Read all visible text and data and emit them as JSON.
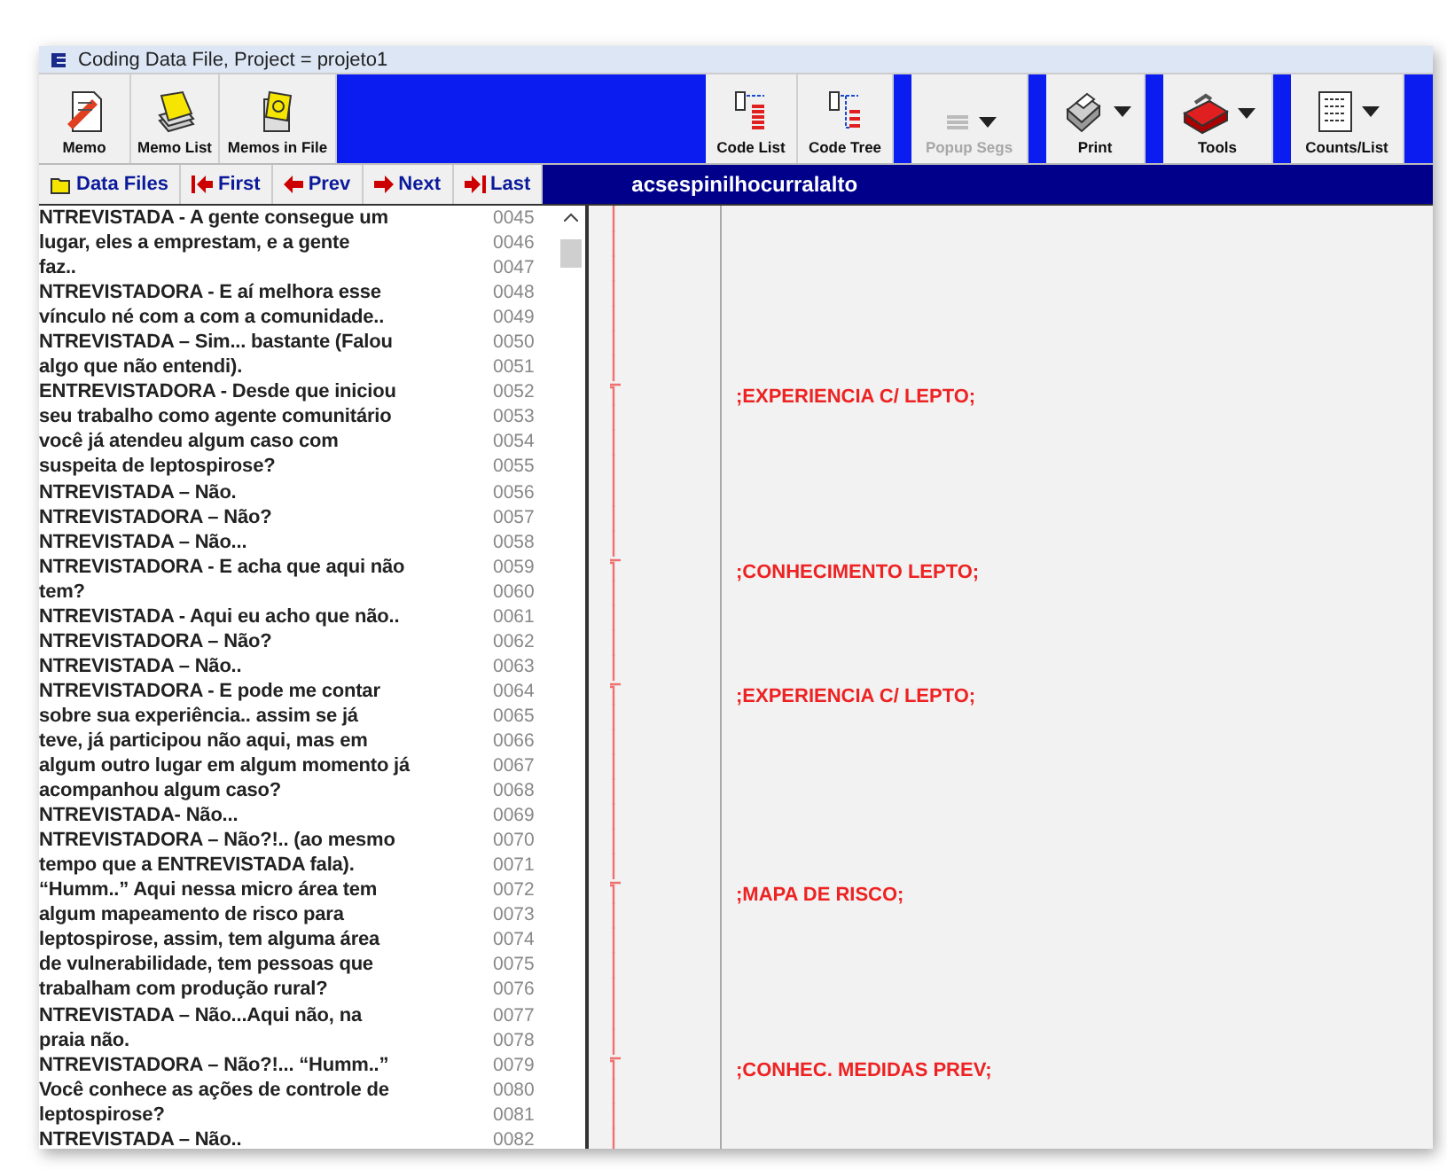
{
  "window": {
    "title": "Coding Data File, Project = projeto1"
  },
  "toolbar": {
    "left": [
      {
        "label": "Memo",
        "kind": "button",
        "disabled": false
      },
      {
        "label": "Memo List",
        "kind": "button",
        "disabled": false
      },
      {
        "label": "Memos in File",
        "kind": "button",
        "disabled": false
      }
    ],
    "right": [
      {
        "label": "Code List",
        "kind": "button",
        "disabled": false
      },
      {
        "label": "Code Tree",
        "kind": "button",
        "disabled": false
      },
      {
        "label": "Popup Segs",
        "kind": "dropdown",
        "disabled": true
      },
      {
        "label": "Print",
        "kind": "dropdown",
        "disabled": false
      },
      {
        "label": "Tools",
        "kind": "dropdown",
        "disabled": false
      },
      {
        "label": "Counts/List",
        "kind": "dropdown",
        "disabled": false
      }
    ]
  },
  "nav": [
    {
      "label": "Data Files"
    },
    {
      "label": "First"
    },
    {
      "label": "Prev"
    },
    {
      "label": "Next"
    },
    {
      "label": "Last"
    }
  ],
  "file_name": "acsespinilhocurralalto",
  "lines": [
    {
      "text": "NTREVISTADA - A gente consegue um",
      "number": "0045"
    },
    {
      "text": "lugar, eles a emprestam, e a gente",
      "number": "0046"
    },
    {
      "text": "faz..",
      "number": "0047"
    },
    {
      "text": "NTREVISTADORA - E aí melhora esse",
      "number": "0048"
    },
    {
      "text": "vínculo né com a com a comunidade..",
      "number": "0049"
    },
    {
      "text": "NTREVISTADA – Sim... bastante (Falou",
      "number": "0050"
    },
    {
      "text": "algo que não entendi).",
      "number": "0051"
    },
    {
      "text": "ENTREVISTADORA - Desde que iniciou",
      "number": "0052",
      "code": ";EXPERIENCIA C/ LEPTO;"
    },
    {
      "text": "seu trabalho como agente comunitário",
      "number": "0053"
    },
    {
      "text": "você já atendeu algum caso com",
      "number": "0054"
    },
    {
      "text": "suspeita de leptospirose?",
      "number": "0055"
    },
    {
      "text": "NTREVISTADA – Não.",
      "number": "0056"
    },
    {
      "text": "NTREVISTADORA – Não?",
      "number": "0057"
    },
    {
      "text": "NTREVISTADA – Não...",
      "number": "0058"
    },
    {
      "text": "NTREVISTADORA - E acha que aqui não",
      "number": "0059",
      "code": ";CONHECIMENTO LEPTO;"
    },
    {
      "text": "tem?",
      "number": "0060"
    },
    {
      "text": "NTREVISTADA - Aqui eu acho que não..",
      "number": "0061"
    },
    {
      "text": "NTREVISTADORA – Não?",
      "number": "0062"
    },
    {
      "text": "NTREVISTADA – Não..",
      "number": "0063"
    },
    {
      "text": "NTREVISTADORA - E pode me contar",
      "number": "0064",
      "code": ";EXPERIENCIA C/ LEPTO;"
    },
    {
      "text": "sobre sua experiência.. assim se já",
      "number": "0065"
    },
    {
      "text": "teve, já participou não aqui, mas em",
      "number": "0066"
    },
    {
      "text": "algum outro lugar em algum momento já",
      "number": "0067"
    },
    {
      "text": "acompanhou algum caso?",
      "number": "0068"
    },
    {
      "text": "NTREVISTADA- Não...",
      "number": "0069"
    },
    {
      "text": "NTREVISTADORA – Não?!.. (ao mesmo",
      "number": "0070"
    },
    {
      "text": "tempo que a ENTREVISTADA fala).",
      "number": "0071"
    },
    {
      "text": "“Humm..” Aqui nessa micro área tem",
      "number": "0072",
      "code": ";MAPA DE RISCO;"
    },
    {
      "text": "algum mapeamento de risco para",
      "number": "0073"
    },
    {
      "text": "leptospirose, assim, tem alguma área",
      "number": "0074"
    },
    {
      "text": "de vulnerabilidade, tem pessoas que",
      "number": "0075"
    },
    {
      "text": "trabalham com produção rural?",
      "number": "0076"
    },
    {
      "text": "NTREVISTADA – Não...Aqui não, na",
      "number": "0077"
    },
    {
      "text": "praia não.",
      "number": "0078"
    },
    {
      "text": "NTREVISTADORA – Não?!... “Humm..”",
      "number": "0079",
      "code": ";CONHEC. MEDIDAS PREV;"
    },
    {
      "text": "Você conhece as ações de controle de",
      "number": "0080"
    },
    {
      "text": "leptospirose?",
      "number": "0081"
    },
    {
      "text": "NTREVISTADA – Não..",
      "number": "0082"
    }
  ]
}
